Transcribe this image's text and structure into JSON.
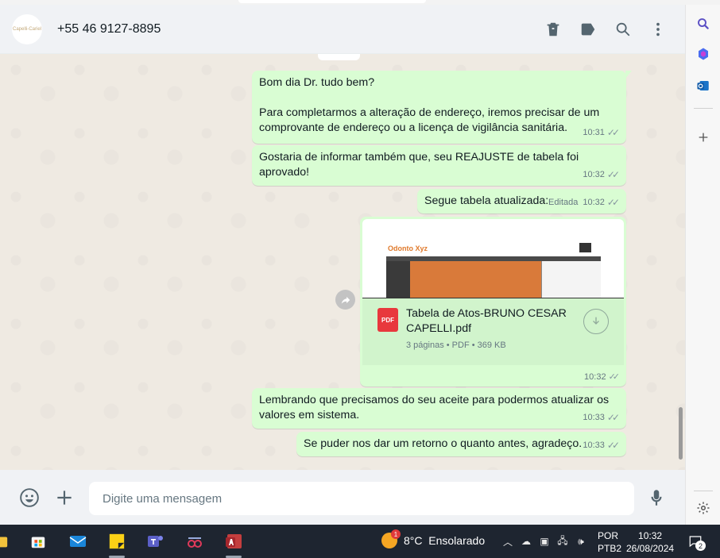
{
  "header": {
    "avatar_text": "Capelli-Cariel",
    "contact": "+55 46 9127-8895",
    "actions": [
      "delete-icon",
      "label-icon",
      "search-icon",
      "menu-icon"
    ]
  },
  "messages": [
    {
      "text": "Bom dia Dr. tudo bem?\n\nPara completarmos a alteração de endereço, iremos precisar de um comprovante de endereço ou a licença de vigilância sanitária.",
      "time": "10:31"
    },
    {
      "text": "Gostaria de informar também que, seu REAJUSTE de tabela foi aprovado!",
      "time": "10:32"
    },
    {
      "text": "Segue tabela atualizada:",
      "edited": "Editada",
      "time": "10:32"
    },
    {
      "text": "Lembrando que precisamos do seu aceite para podermos atualizar os valores em sistema.",
      "time": "10:33"
    },
    {
      "text": "Se puder nos dar um retorno o quanto antes, agradeço.",
      "time": "10:33"
    }
  ],
  "document": {
    "icon_label": "PDF",
    "name": "Tabela de Atos-BRUNO CESAR CAPELLI.pdf",
    "details": "3 páginas • PDF • 369 KB",
    "time": "10:32",
    "preview_logo": "Odonto",
    "preview_logo_accent": "Xyz"
  },
  "composer": {
    "placeholder": "Digite uma mensagem"
  },
  "taskbar": {
    "weather_badge": "1",
    "weather": "8°C  Ensolarado",
    "language_top": "POR",
    "language_bottom": "PTB2",
    "time": "10:32",
    "date": "26/08/2024",
    "notifications": "2"
  },
  "colors": {
    "bubble": "#d9fdd3",
    "chat_bg": "#efeae2",
    "header_bg": "#f0f2f5",
    "taskbar": "#1e2530"
  }
}
